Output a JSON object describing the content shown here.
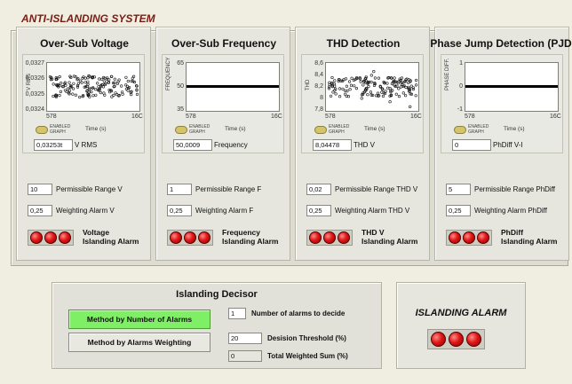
{
  "app_title": "ANTI-ISLANDING SYSTEM",
  "colors": {
    "led_on": "#e01616",
    "active_button": "#7ff065",
    "title": "#7a1c14"
  },
  "panels": [
    {
      "title": "Over-Sub Voltage",
      "y_axis_label": "V RMS",
      "y_ticks": [
        "0,0327",
        "0,0326",
        "0,0325",
        "0,0324"
      ],
      "x_ticks": [
        "578",
        "16C"
      ],
      "x_unit": "Time (s)",
      "toggle_label": "ENABLED GRAPH",
      "readout_value": "0,03253t",
      "readout_label": "V RMS",
      "range_value": "10",
      "range_label": "Permissible Range V",
      "weight_value": "0,25",
      "weight_label": "Weighting Alarm V",
      "alarm_label_1": "Voltage",
      "alarm_label_2": "Islanding Alarm"
    },
    {
      "title": "Over-Sub Frequency",
      "y_axis_label": "FREQUENCY",
      "y_ticks": [
        "65",
        "50",
        "35"
      ],
      "x_ticks": [
        "578",
        "16C"
      ],
      "x_unit": "Time (s)",
      "toggle_label": "ENABLED GRAPH",
      "readout_value": "50,0009",
      "readout_label": "Frequency",
      "range_value": "1",
      "range_label": "Permissible Range F",
      "weight_value": "0,25",
      "weight_label": "Weighting Alarm F",
      "alarm_label_1": "Frequency",
      "alarm_label_2": "Islanding Alarm"
    },
    {
      "title": "THD Detection",
      "y_axis_label": "THD",
      "y_ticks": [
        "8,6",
        "8,4",
        "8,2",
        "8",
        "7,8"
      ],
      "x_ticks": [
        "578",
        "16C"
      ],
      "x_unit": "Time (s)",
      "toggle_label": "ENABLED GRAPH",
      "readout_value": "8,04478",
      "readout_label": "THD V",
      "range_value": "0,02",
      "range_label": "Permissible Range THD V",
      "weight_value": "0,25",
      "weight_label": "Weighting Alarm THD V",
      "alarm_label_1": "THD V",
      "alarm_label_2": "Islanding Alarm"
    },
    {
      "title": "Phase Jump Detection (PJD)",
      "y_axis_label": "PHASE DIFF.",
      "y_ticks": [
        "1",
        "0",
        "-1"
      ],
      "x_ticks": [
        "578",
        "16C"
      ],
      "x_unit": "Time (s)",
      "toggle_label": "ENABLED GRAPH",
      "readout_value": "0",
      "readout_label": "PhDiff V-I",
      "range_value": "5",
      "range_label": "Permissible Range PhDiff",
      "weight_value": "0,25",
      "weight_label": "Weighting Alarm PhDiff",
      "alarm_label_1": "PhDiff",
      "alarm_label_2": "Islanding Alarm"
    }
  ],
  "decisor": {
    "title": "Islanding Decisor",
    "method_count_label": "Method by Number of Alarms",
    "method_weight_label": "Method by Alarms Weighting",
    "alarms_to_decide_value": "1",
    "alarms_to_decide_label": "Number of alarms to decide",
    "threshold_value": "20",
    "threshold_label": "Desision Threshold (%)",
    "weighted_sum_value": "0",
    "weighted_sum_label": "Total Weighted Sum (%)"
  },
  "islanding_alarm": {
    "title": "ISLANDING ALARM"
  }
}
